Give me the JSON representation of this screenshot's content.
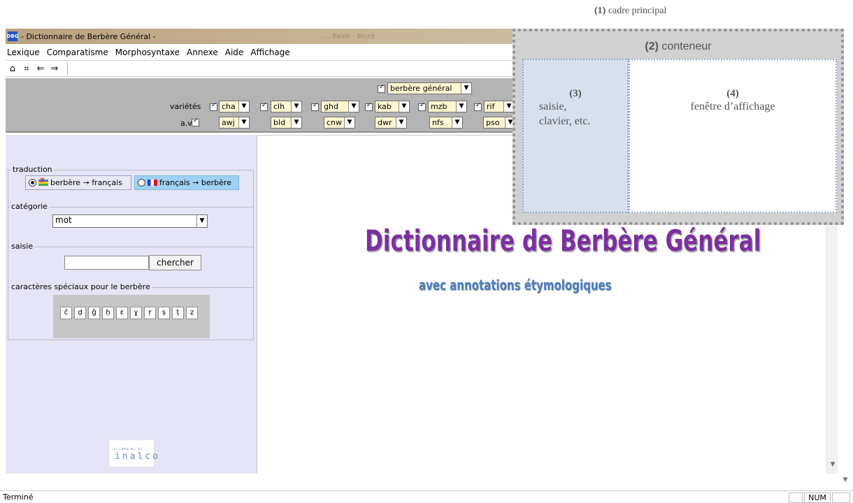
{
  "annotation": {
    "main_frame_num": "(1)",
    "main_frame_text": " cadre principal",
    "container_num": "(2)",
    "container_text": " conteneur",
    "input_num": "(3)",
    "input_text_1": "saisie,",
    "input_text_2": "clavier, etc.",
    "display_num": "(4)",
    "display_text": "fenêtre d’affichage"
  },
  "window": {
    "icon_text": "DBG",
    "title": "- Dictionnaire de Berbère Général -",
    "ghost_title": "… Paint · Word"
  },
  "menu": [
    "Lexique",
    "Comparatisme",
    "Morphosyntaxe",
    "Annexe",
    "Aide",
    "Affichage"
  ],
  "toolbar": {
    "home": "⌂",
    "grid": "⌗",
    "back": "⇐",
    "forward": "⇒"
  },
  "varieties": {
    "general_label": "berbère général",
    "label": "variétés",
    "av_label": "a.v.",
    "row1": [
      "cha",
      "clh",
      "ghd",
      "kab",
      "mzb",
      "rif"
    ],
    "row2": [
      "awj",
      "bld",
      "cnw",
      "dwr",
      "nfs",
      "pso"
    ]
  },
  "left": {
    "traduction_legend": "traduction",
    "option_ber_fr": "berbère → français",
    "option_fr_ber": "français → berbère",
    "categorie_legend": "catégorie",
    "categorie_value": "mot",
    "saisie_legend": "saisie",
    "search_value": "",
    "search_button": "chercher",
    "chars_legend": "caractères spéciaux pour le berbère",
    "chars": [
      "č",
      "ḍ",
      "ǧ",
      "ḥ",
      "ε",
      "ɣ",
      "ṛ",
      "ṣ",
      "ṭ",
      "ẓ"
    ],
    "logo_small": "ⵉⵏ ⴰⵍⴽⵓ ⵍⴰ ⵍⵉ",
    "logo_name": "inalco"
  },
  "display": {
    "title": "Dictionnaire de Berbère Général",
    "subtitle": "avec annotations étymologiques"
  },
  "status": {
    "text": "Terminé",
    "num": "NUM"
  }
}
